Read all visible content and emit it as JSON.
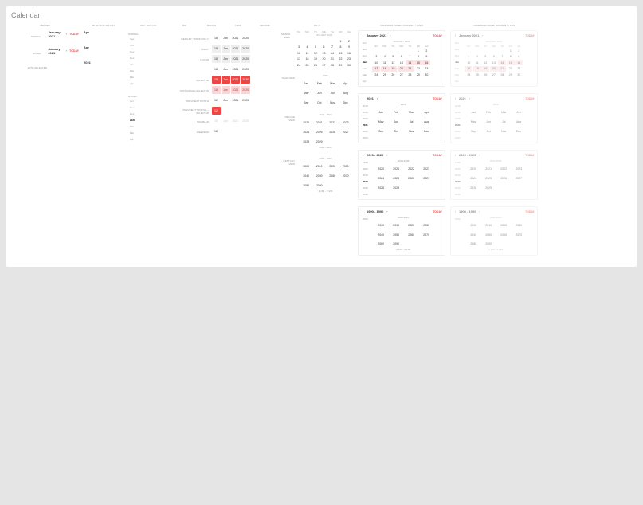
{
  "page_title": "Calendar",
  "columns": [
    "HEADER",
    "WITH MONTHS LIST",
    "UNIT BUTTON",
    "DAY",
    "MONTH",
    "YEAR",
    "DECADE",
    "CENTURY",
    "DAYS",
    "CALENDAR PANEL: NORMAL / TYPE 2",
    "CALENDAR PANEL: DOUBLE TYPES"
  ],
  "rows": {
    "normal": "NORMAL",
    "hover": "HOVER",
    "with_selected": "WITH SELECTED",
    "default_today_only": "DEFAULT / TODAY ONLY",
    "today": "TODAY",
    "selected": "SELECTED",
    "soft_range_selected": "SOFT-RANGE-SELECTED",
    "prev_next_month": "PREV/NEXT MONTH",
    "prev_next_month_selected": "PREV/NEXT MONTH — SELECTED",
    "disabled": "DISABLED",
    "weekend": "WEEKEND",
    "month_view": "MONTH VIEW",
    "year_view": "YEAR VIEW",
    "decade_view": "DECADE VIEW",
    "century_view": "CENTURY VIEW"
  },
  "header": {
    "label": "January 2021",
    "today": "TODAY",
    "mode": "Apr",
    "year": "2021"
  },
  "months_abbr": [
    "Sep",
    "Oct",
    "Nov",
    "Dec",
    "Jan",
    "Feb",
    "Mar",
    "Apr"
  ],
  "months_abbr2": [
    "Oct",
    "Nov",
    "Dec",
    "2021",
    "Feb",
    "Mar",
    "Apr"
  ],
  "unit": {
    "day": "18",
    "month": "Jan",
    "year": "2021",
    "decade": "2020",
    "prev_day": "12"
  },
  "weekdays": [
    "SU",
    "MO",
    "TU",
    "WE",
    "TH",
    "FR",
    "SA"
  ],
  "cal_title": "JANUARY 2021",
  "cal_days_first_blanks": 5,
  "cal_days": [
    1,
    2,
    3,
    4,
    5,
    6,
    7,
    8,
    9,
    10,
    11,
    12,
    13,
    14,
    15,
    16,
    17,
    18,
    19,
    20,
    21,
    22,
    23,
    24,
    25,
    26,
    27,
    28,
    29,
    30
  ],
  "year_title": "2021",
  "year_grid": [
    "Jan",
    "Feb",
    "Mar",
    "Apr",
    "May",
    "Jun",
    "Jul",
    "Aug",
    "Sep",
    "Oct",
    "Nov",
    "Dec"
  ],
  "decade_title": "2020 - 2029",
  "decade_range_sub": "2020 - 2030",
  "decade_grid": [
    "2020",
    "2021",
    "2022",
    "2023",
    "2024",
    "2025",
    "2026",
    "2027",
    "2028",
    "2029"
  ],
  "century_title": "2000 - 2099",
  "century_range_sub": "2 189 - 2 195",
  "century_grid": [
    "2000",
    "2010",
    "2020",
    "2030",
    "2040",
    "2050",
    "2060",
    "2070",
    "2080",
    "2090"
  ],
  "panel1": {
    "header_label": "January 2021",
    "today": "TODAY",
    "sub": "JANUARY 2021",
    "side": [
      "Oct",
      "Nov",
      "Dec",
      "Jan",
      "Feb",
      "Mar",
      "Apr"
    ],
    "days": [
      1,
      2,
      3,
      4,
      5,
      6,
      7,
      8,
      9,
      10,
      11,
      12,
      13,
      14,
      15,
      16,
      17,
      18,
      19,
      20,
      21,
      22,
      23,
      24,
      25,
      26,
      27,
      28,
      29,
      30
    ],
    "range": [
      14,
      15,
      16,
      17,
      18,
      19,
      20,
      21
    ]
  },
  "panel_year": {
    "title": "2021",
    "today": "TODAY",
    "side": [
      "2018",
      "2019",
      "2020",
      "2021",
      "2022",
      "2023"
    ],
    "grid": [
      "Jan",
      "Feb",
      "Mar",
      "Apr",
      "May",
      "Jun",
      "Jul",
      "Aug",
      "Sep",
      "Oct",
      "Nov",
      "Dec"
    ],
    "sub": "2020"
  },
  "panel_decade": {
    "title": "2020 - 2029",
    "today": "TODAY",
    "side": [
      "1990",
      "2000",
      "2010",
      "2020",
      "2030",
      "2040"
    ],
    "sub": "2024-2099",
    "grid": [
      "2020",
      "2021",
      "2022",
      "2023",
      "2024",
      "2025",
      "2026",
      "2027",
      "2028",
      "2029"
    ]
  },
  "panel_century": {
    "title": "1900 - 1990",
    "today": "TODAY",
    "side": [
      "2000"
    ],
    "sub": "2000-2010",
    "grid": [
      "2000",
      "2010",
      "2020",
      "2030",
      "2040",
      "2050",
      "2060",
      "2070"
    ],
    "extra": [
      "2080",
      "2090"
    ],
    "foot": "2 189 - 2 195"
  },
  "chevron_left": "‹",
  "chevron_right": "›"
}
